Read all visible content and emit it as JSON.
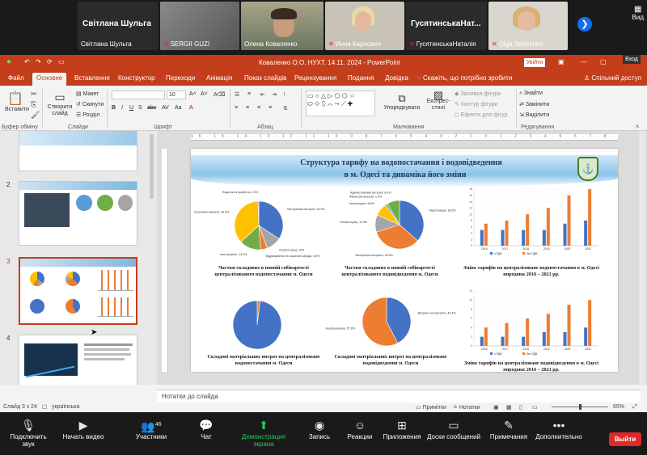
{
  "zoom": {
    "participants": [
      {
        "name": "Світлана Шульга",
        "big": "Світлана Шульга",
        "muted": false
      },
      {
        "name": "SERGII GUZI",
        "muted": true
      },
      {
        "name": "Олена Коваленко",
        "muted": false
      },
      {
        "name": "Инна Карпович",
        "muted": true
      },
      {
        "name": "ГусятинськаНаталія",
        "big": "ГусятинськаНат...",
        "muted": true
      },
      {
        "name": "Olga Selreshko",
        "muted": true
      }
    ],
    "view_label": "Вид",
    "enter_label": "Вход",
    "toolbar": {
      "mute": "Подключить звук",
      "video": "Начать видео",
      "participants": "Участники",
      "participants_count": "46",
      "chat": "Чат",
      "share": "Демонстрация экрана",
      "record": "Запись",
      "reactions": "Реакции",
      "apps": "Приложения",
      "whiteboard": "Доски сообщений",
      "notes": "Примечания",
      "more": "Дополнительно",
      "leave": "Выйти"
    }
  },
  "ppt": {
    "title": "Коваленко О.О. НУХТ. 14.11. 2024  -  PowerPoint",
    "signin": "Увійти",
    "tabs": [
      "Файл",
      "Основне",
      "Вставлення",
      "Конструктор",
      "Переходи",
      "Анімація",
      "Показ слайдів",
      "Рецензування",
      "Подання",
      "Довідка",
      "Скажіть, що потрібно зробити",
      "Спільний доступ"
    ],
    "ribbon": {
      "paste": "Вставити",
      "new_slide": "Створити слайд",
      "layout": "Макет",
      "reset": "Скинути",
      "section": "Розділ",
      "font_size": "10",
      "arrange": "Упорядкувати",
      "quick_styles": "Експрес-стилі",
      "shape_fill": "Заливка фігури",
      "shape_outline": "Контур фігури",
      "shape_effects": "Ефекти для фігур",
      "find": "Знайти",
      "replace": "Замінити",
      "select": "Виділити",
      "groups": [
        "Буфер обміну",
        "Слайди",
        "Шрифт",
        "Абзац",
        "Малювання",
        "Редагування"
      ]
    },
    "slide_numbers": [
      "2",
      "3",
      "4"
    ],
    "notes_placeholder": "Нотатки до слайда",
    "status": {
      "slide_info": "Слайд 3 з 24",
      "language": "українська",
      "notes": "Нотатки",
      "comments": "Примітки",
      "zoom": "65%"
    },
    "slide": {
      "title_line1": "Структура тарифу на водопостачання і водовідведення",
      "title_line2": "в м. Одесі та динаміка його зміни",
      "captions": [
        "Частки складових в повній собівартості централізованого водопостачання м. Одеси",
        "Частки складових в повній собівартості централізованого водовідведення м. Одеси",
        "Зміна тарифів на централізоване водопостачання в м. Одесі впродовж 2016 – 2021 рр.",
        "Складові матеріальних витрат на централізоване водопостачання м. Одеси",
        "Складові матеріальних витрат на централізоване водовідведення м. Одеси",
        "Зміна тарифів на централізоване водовідведення в м. Одесі впродовж 2016 – 2021 рр."
      ]
    }
  },
  "chart_data": [
    {
      "type": "pie",
      "title": "Частки складових в повній собівартості централізованого водопостачання м. Одеси",
      "labels": [
        "Матеріальні витрати",
        "Оплата праці",
        "Відрахування на соціальні заходи",
        "Інші витрати",
        "Адміністративні витрати",
        "Податок на прибуток"
      ],
      "values": [
        34.5,
        10,
        4.5,
        14.5,
        36.5,
        0.5
      ],
      "colors": [
        "#4472c4",
        "#a5a5a5",
        "#ed7d31",
        "#70ad47",
        "#ffc000",
        "#264478"
      ]
    },
    {
      "type": "pie",
      "title": "Частки складових в повній собівартості централізованого водовідведення м. Одеси",
      "labels": [
        "Амортизація",
        "Матеріальні витрати",
        "Оплата праці",
        "Інші витрати",
        "Фінансові витрати",
        "Адміністративні витрати"
      ],
      "values": [
        36.5,
        33.5,
        11.5,
        8.6,
        1.5,
        8.4
      ],
      "colors": [
        "#4472c4",
        "#ed7d31",
        "#a5a5a5",
        "#ffc000",
        "#5b9bd5",
        "#70ad47"
      ]
    },
    {
      "type": "pie",
      "title": "Складові матеріальних витрат на централізоване водопостачання м. Одеси",
      "labels": [
        "Витрати на реагенти",
        "Витрати на електроенергію"
      ],
      "values": [
        2,
        98
      ],
      "colors": [
        "#ed7d31",
        "#4472c4"
      ]
    },
    {
      "type": "pie",
      "title": "Складові матеріальних витрат на централізоване водовідведення м. Одеси",
      "labels": [
        "Витрати на реагенти",
        "Витрати на електроенергію"
      ],
      "values": [
        42.4,
        57.6
      ],
      "colors": [
        "#4472c4",
        "#ed7d31"
      ]
    },
    {
      "type": "bar",
      "title": "Зміна тарифів на централізоване водопостачання в м. Одесі впродовж 2016 – 2021 рр.",
      "categories": [
        "2016",
        "2017",
        "2018",
        "2019",
        "2020",
        "2021"
      ],
      "series": [
        {
          "name": "з ПДВ",
          "values": [
            5,
            5,
            5,
            5,
            7,
            8
          ]
        },
        {
          "name": "без ПДВ",
          "values": [
            7,
            8,
            10,
            12,
            16,
            18
          ]
        }
      ],
      "ylim": [
        0,
        18
      ],
      "colors": [
        "#4472c4",
        "#ed7d31"
      ]
    },
    {
      "type": "bar",
      "title": "Зміна тарифів на централізоване водовідведення в м. Одесі впродовж 2016 – 2021 рр.",
      "categories": [
        "2016",
        "2017",
        "2018",
        "2019",
        "2020",
        "2021"
      ],
      "series": [
        {
          "name": "з ПДВ",
          "values": [
            2,
            2,
            2,
            3,
            3,
            4
          ]
        },
        {
          "name": "без ПДВ",
          "values": [
            4,
            5,
            6,
            7,
            9,
            10
          ]
        }
      ],
      "ylim": [
        0,
        12
      ],
      "colors": [
        "#4472c4",
        "#ed7d31"
      ]
    }
  ]
}
